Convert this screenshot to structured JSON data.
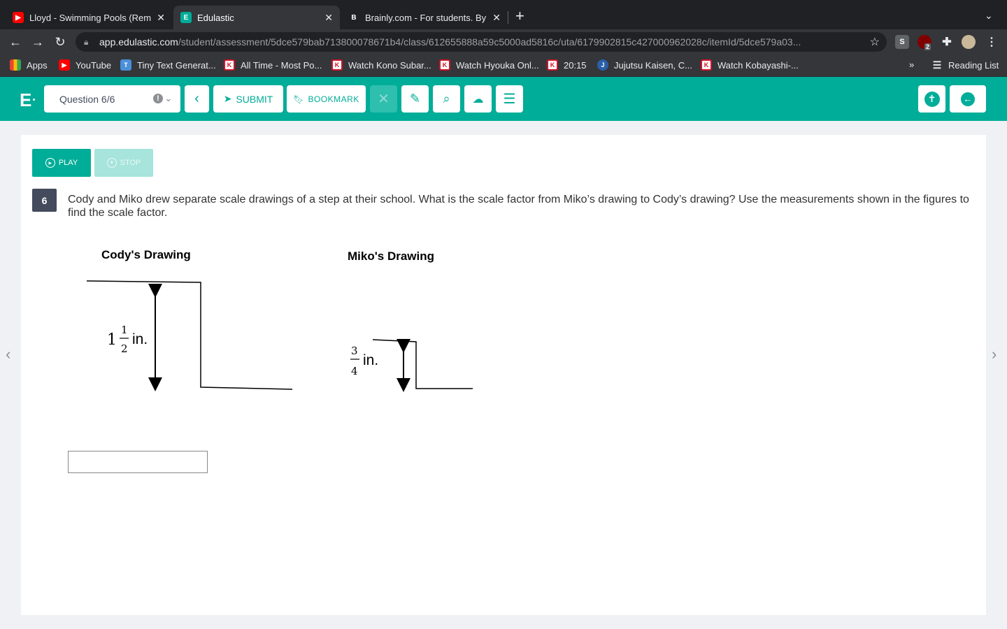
{
  "browser": {
    "tabs": [
      {
        "title": "Lloyd - Swimming Pools (Remi",
        "active": false
      },
      {
        "title": "Edulastic",
        "active": true
      },
      {
        "title": "Brainly.com - For students. By",
        "active": false
      }
    ],
    "url_host": "app.edulastic.com",
    "url_path": "/student/assessment/5dce579bab713800078671b4/class/612655888a59c5000ad5816c/uta/6179902815c427000962028c/itemId/5dce579a03...",
    "extension_badge": "2",
    "bookmarks": [
      "Apps",
      "YouTube",
      "Tiny Text Generat...",
      "All Time - Most Po...",
      "Watch Kono Subar...",
      "Watch Hyouka Onl...",
      "20:15",
      "Jujutsu Kaisen, C...",
      "Watch Kobayashi-..."
    ],
    "bookmarks_overflow": "»",
    "reading_list": "Reading List"
  },
  "app": {
    "logo": "E",
    "question_selector": "Question 6/6",
    "submit_label": "SUBMIT",
    "bookmark_label": "BOOKMARK",
    "accent_color": "#00ad98"
  },
  "player": {
    "play_label": "PLAY",
    "stop_label": "STOP"
  },
  "question": {
    "number": "6",
    "text": "Cody and Miko drew separate scale drawings of a step at their school.  What is the scale factor from Miko’s drawing to Cody’s drawing?  Use the measurements shown in the figures to find the scale factor.",
    "answer_value": ""
  },
  "figure": {
    "cody_title": "Cody's Drawing",
    "cody_whole": "1",
    "cody_num": "1",
    "cody_den": "2",
    "cody_unit": "in.",
    "miko_title": "Miko's Drawing",
    "miko_num": "3",
    "miko_den": "4",
    "miko_unit": "in."
  }
}
